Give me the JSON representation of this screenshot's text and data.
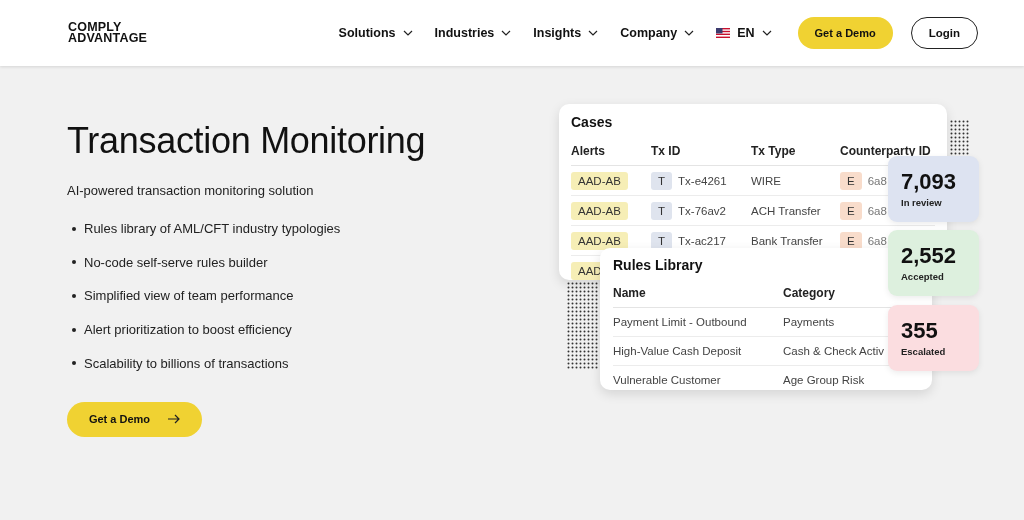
{
  "header": {
    "logo": [
      "COMPLY",
      "ADVANTAGE"
    ],
    "nav": [
      {
        "label": "Solutions",
        "kind": "menu"
      },
      {
        "label": "Industries",
        "kind": "menu"
      },
      {
        "label": "Insights",
        "kind": "menu"
      },
      {
        "label": "Company",
        "kind": "menu"
      },
      {
        "label": "EN",
        "kind": "language"
      }
    ],
    "demo_button": "Get a Demo",
    "login_button": "Login"
  },
  "hero": {
    "title": "Transaction Monitoring",
    "subtitle": "AI-powered transaction monitoring solution",
    "bullets": [
      "Rules library of AML/CFT industry typologies",
      "No-code self-serve rules builder",
      "Simplified view of team performance",
      "Alert prioritization to boost efficiency",
      "Scalability to billions of transactions"
    ],
    "cta": "Get a Demo"
  },
  "cases": {
    "title": "Cases",
    "columns": [
      "Alerts",
      "Tx ID",
      "Tx Type",
      "Counterparty ID"
    ],
    "rows": [
      {
        "alert": "AAD-AB",
        "tx_tag": "T",
        "tx_id": "Tx-e4261",
        "tx_type": "WIRE",
        "cp_tag": "E",
        "cp_id": "6a8"
      },
      {
        "alert": "AAD-AB",
        "tx_tag": "T",
        "tx_id": "Tx-76av2",
        "tx_type": "ACH Transfer",
        "cp_tag": "E",
        "cp_id": "6a8"
      },
      {
        "alert": "AAD-AB",
        "tx_tag": "T",
        "tx_id": "Tx-ac217",
        "tx_type": "Bank Transfer",
        "cp_tag": "E",
        "cp_id": "6a8"
      },
      {
        "alert": "AAD"
      }
    ]
  },
  "rules_library": {
    "title": "Rules Library",
    "columns": [
      "Name",
      "Category"
    ],
    "rows": [
      [
        "Payment Limit - Outbound",
        "Payments"
      ],
      [
        "High-Value Cash Deposit",
        "Cash & Check Activ"
      ],
      [
        "Vulnerable Customer",
        "Age Group Risk"
      ]
    ]
  },
  "stats": [
    {
      "value": "7,093",
      "label": "In review",
      "color": "#dde3f1"
    },
    {
      "value": "2,552",
      "label": "Accepted",
      "color": "#ddf0de"
    },
    {
      "value": "355",
      "label": "Escalated",
      "color": "#fbdde0"
    }
  ]
}
